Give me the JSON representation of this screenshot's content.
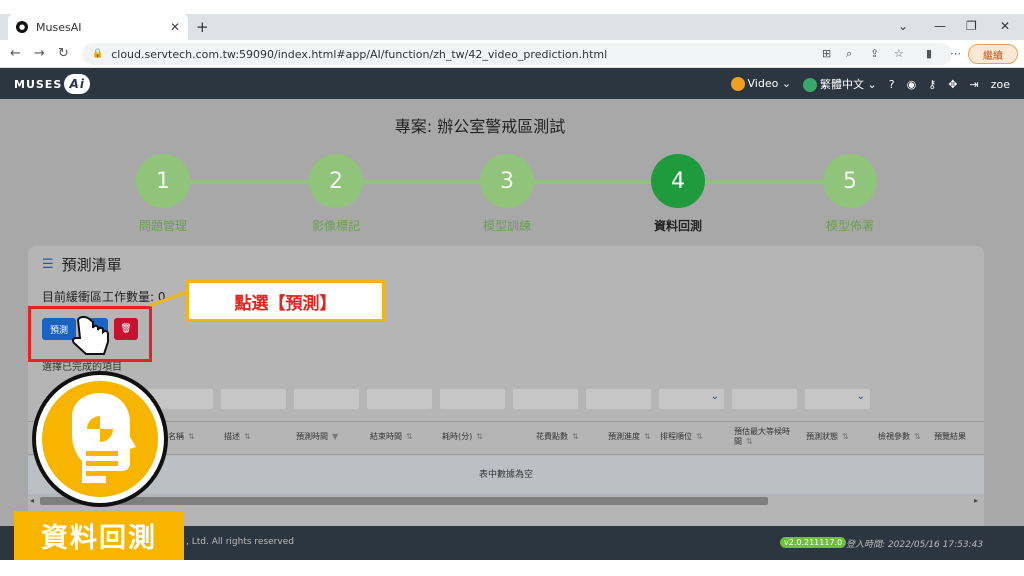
{
  "browser": {
    "tab_title": "MusesAI",
    "new_tab": "+",
    "url": "cloud.servtech.com.tw:59090/index.html#app/AI/function/zh_tw/42_video_prediction.html",
    "profile_label": "繼續"
  },
  "nav": {
    "logo_text": "MUSES",
    "logo_ai": "Ai",
    "video_label": "Video",
    "language_label": "繁體中文",
    "user": "zoe"
  },
  "page": {
    "project_title": "專案: 辦公室警戒區測試",
    "steps": [
      {
        "num": "1",
        "label": "問題管理"
      },
      {
        "num": "2",
        "label": "影像標記"
      },
      {
        "num": "3",
        "label": "模型訓練"
      },
      {
        "num": "4",
        "label": "資料回測"
      },
      {
        "num": "5",
        "label": "模型佈署"
      }
    ],
    "active_step": 4
  },
  "card": {
    "title": "預測清單",
    "buffer_text": "目前緩衝區工作數量: 0",
    "predict_button": "預測",
    "delete_icon": "🗑",
    "selected_text": "選擇已完成的項目",
    "table_headers": [
      "名稱",
      "描述",
      "預測時間",
      "結束時間",
      "耗時(分)",
      "花費點數",
      "預測進度",
      "排程順位",
      "預估最大等候時間",
      "預測狀態",
      "檢視參數",
      "預覽結果"
    ],
    "empty_text": "表中數據為空"
  },
  "footer": {
    "copyright": ", Ltd. All rights reserved",
    "version": "v2.0.211117.0",
    "login_time": "登入時間: 2022/05/16 17:53:43"
  },
  "overlay": {
    "callout_text": "點選【預測】",
    "badge_label": "資料回測"
  }
}
